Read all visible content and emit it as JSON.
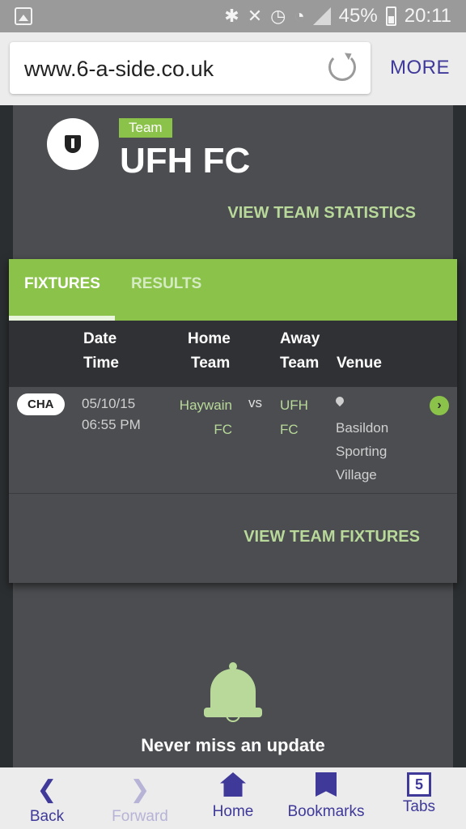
{
  "status_bar": {
    "battery": "45%",
    "time": "20:11"
  },
  "browser": {
    "url": "www.6-a-side.co.uk",
    "more_label": "MORE"
  },
  "team": {
    "tag": "Team",
    "name": "UFH FC",
    "view_stats": "VIEW TEAM STATISTICS"
  },
  "fixtures": {
    "tabs": [
      {
        "label": "FIXTURES",
        "active": true
      },
      {
        "label": "RESULTS",
        "active": false
      }
    ],
    "headers": {
      "date": "Date",
      "time": "Time",
      "home": "Home",
      "home2": "Team",
      "away": "Away",
      "away2": "Team",
      "venue": "Venue"
    },
    "rows": [
      {
        "competition": "CHA",
        "date": "05/10/15",
        "time": "06:55 PM",
        "home_line1": "Haywain",
        "home_line2": "FC",
        "vs": "vs",
        "away_line1": "UFH",
        "away_line2": "FC",
        "venue_line1": "Basildon",
        "venue_line2": "Sporting",
        "venue_line3": "Village"
      }
    ],
    "view_fixtures": "VIEW TEAM FIXTURES"
  },
  "update_card": {
    "text": "Never miss an update"
  },
  "bottom_nav": {
    "back": "Back",
    "forward": "Forward",
    "home": "Home",
    "bookmarks": "Bookmarks",
    "tabs": "Tabs",
    "tabs_count": "5"
  },
  "colors": {
    "accent_green": "#8bc34a",
    "link_green": "#b8d99a",
    "browser_purple": "#3f3a9a",
    "card_bg": "#4b4d50"
  }
}
